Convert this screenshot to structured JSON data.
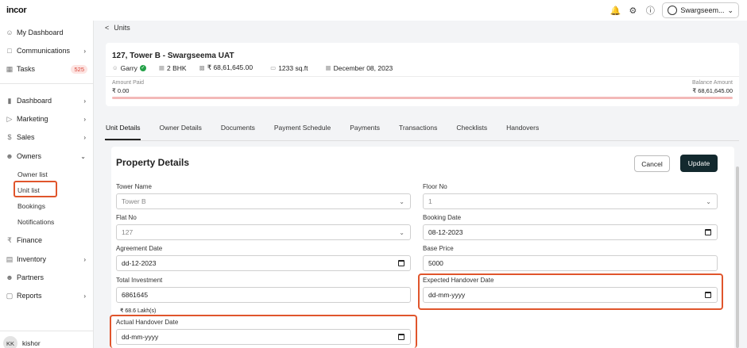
{
  "app": {
    "logo": "incor"
  },
  "topbar": {
    "workspace": "Swargseem..."
  },
  "sidebar": {
    "items": [
      {
        "label": "My Dashboard",
        "icon": "user-icon"
      },
      {
        "label": "Communications",
        "icon": "chat-icon"
      },
      {
        "label": "Tasks",
        "icon": "calendar-icon",
        "badge": "525"
      },
      {
        "label": "Dashboard",
        "icon": "bar-chart-icon"
      },
      {
        "label": "Marketing",
        "icon": "megaphone-icon"
      },
      {
        "label": "Sales",
        "icon": "dollar-icon"
      },
      {
        "label": "Owners",
        "icon": "users-icon"
      },
      {
        "label": "Finance",
        "icon": "rupee-icon"
      },
      {
        "label": "Inventory",
        "icon": "chart-icon"
      },
      {
        "label": "Partners",
        "icon": "partners-icon"
      },
      {
        "label": "Reports",
        "icon": "report-icon"
      }
    ],
    "owners_sub": [
      "Owner list",
      "Unit list",
      "Bookings",
      "Notifications"
    ],
    "user": {
      "initials": "KK",
      "name": "kishor"
    }
  },
  "breadcrumb": {
    "back": "<",
    "label": "Units"
  },
  "unit": {
    "title": "127, Tower B - Swargseema UAT",
    "owner": "Garry",
    "type": "2 BHK",
    "price": "₹ 68,61,645.00",
    "area": "1233 sq.ft",
    "date": "December 08, 2023",
    "amount_paid_label": "Amount Paid",
    "amount_paid": "₹ 0.00",
    "balance_label": "Balance Amount",
    "balance": "₹ 68,61,645.00",
    "paid_fraction": 0.0
  },
  "tabs": [
    "Unit Details",
    "Owner Details",
    "Documents",
    "Payment Schedule",
    "Payments",
    "Transactions",
    "Checklists",
    "Handovers"
  ],
  "property": {
    "title": "Property Details",
    "cancel": "Cancel",
    "update": "Update",
    "tower_name_label": "Tower Name",
    "tower_name": "Tower B",
    "floor_no_label": "Floor No",
    "floor_no": "1",
    "flat_no_label": "Flat No",
    "flat_no": "127",
    "booking_date_label": "Booking Date",
    "booking_date": "08-12-2023",
    "agreement_date_label": "Agreement Date",
    "agreement_date": "dd-12-2023",
    "base_price_label": "Base Price",
    "base_price": "5000",
    "total_investment_label": "Total Investment",
    "total_investment": "6861645",
    "total_investment_hint": "₹ 68.6 Lakh(s)",
    "expected_handover_label": "Expected Handover Date",
    "expected_handover": "dd-mm-yyyy",
    "actual_handover_label": "Actual Handover Date",
    "actual_handover": "dd-mm-yyyy"
  },
  "colors": {
    "highlight": "#e0552c",
    "primary_button": "#13292e",
    "badge_text": "#d9473a"
  }
}
